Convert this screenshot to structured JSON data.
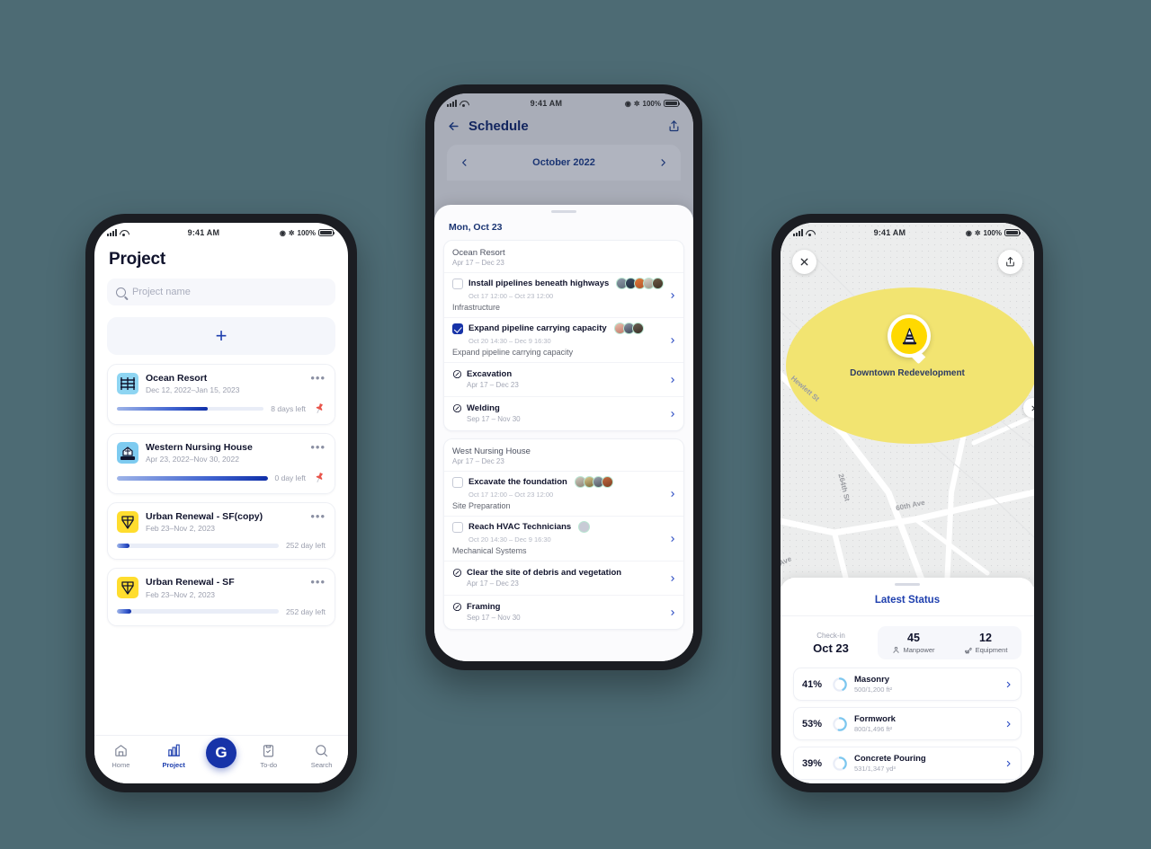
{
  "theme": {
    "background": "#4d6b74",
    "accent": "#1733a8",
    "yellow": "#ffd900",
    "zone": "#f2e471"
  },
  "status_bar": {
    "time": "9:41 AM",
    "battery": "100%"
  },
  "project_screen": {
    "title": "Project",
    "search": {
      "placeholder": "Project name"
    },
    "add_label": "+",
    "projects": [
      {
        "name": "Ocean Resort",
        "dates": "Dec 12, 2022–Jan 15, 2023",
        "progress": 62,
        "days_left": "8 days left",
        "pinned": true,
        "icon": "scaffold-icon",
        "icon_color": "#8ed5f2"
      },
      {
        "name": "Western Nursing House",
        "dates": "Apr 23, 2022–Nov 30, 2022",
        "progress": 100,
        "days_left": "0 day left",
        "pinned": true,
        "icon": "building-icon",
        "icon_color": "#7ecbf0"
      },
      {
        "name": "Urban Renewal - SF(copy)",
        "dates": "Feb 23–Nov 2, 2023",
        "progress": 8,
        "days_left": "252 day left",
        "pinned": false,
        "icon": "gem-icon",
        "icon_color": "#ffdd2e"
      },
      {
        "name": "Urban Renewal - SF",
        "dates": "Feb 23–Nov 2, 2023",
        "progress": 9,
        "days_left": "252 day left",
        "pinned": false,
        "icon": "gem-icon",
        "icon_color": "#ffdd2e"
      }
    ],
    "tabs": [
      {
        "label": "Home",
        "icon": "home-icon",
        "active": false
      },
      {
        "label": "Project",
        "icon": "project-icon",
        "active": true
      },
      {
        "label": "To-do",
        "icon": "todo-icon",
        "active": false
      },
      {
        "label": "Search",
        "icon": "search-icon",
        "active": false
      }
    ],
    "fab_label": "G"
  },
  "schedule_screen": {
    "title": "Schedule",
    "month": "October 2022",
    "day_label": "Mon, Oct 23",
    "groups": [
      {
        "name": "Ocean Resort",
        "dates": "Apr 17 – Dec 23",
        "tasks": [
          {
            "name": "Install pipelines beneath highways",
            "dates": "Oct 17 12:00 – Oct 23 12:00",
            "category": "Infrastructure",
            "checked": false,
            "avatars": 5
          },
          {
            "name": "Expand pipeline carrying capacity",
            "dates": "Oct 20 14:30 – Dec 9 16:30",
            "category": "Expand pipeline carrying capacity",
            "checked": true,
            "avatars": 3
          }
        ],
        "milestones": [
          {
            "name": "Excavation",
            "dates": "Apr 17 – Dec 23"
          },
          {
            "name": "Welding",
            "dates": "Sep 17 – Nov 30"
          }
        ]
      },
      {
        "name": "West Nursing House",
        "dates": "Apr 17 – Dec 23",
        "tasks": [
          {
            "name": "Excavate the foundation",
            "dates": "Oct 17 12:00 – Oct 23 12:00",
            "category": "Site Preparation",
            "checked": false,
            "avatars": 4
          },
          {
            "name": "Reach HVAC Technicians",
            "dates": "Oct 20 14:30 – Dec 9 16:30",
            "category": "Mechanical Systems",
            "checked": false,
            "avatars": 1
          }
        ],
        "milestones": [
          {
            "name": "Clear the site of debris and vegetation",
            "dates": "Apr 17 – Dec 23"
          },
          {
            "name": "Framing",
            "dates": "Sep 17 – Nov 30"
          }
        ]
      }
    ]
  },
  "map_screen": {
    "marker_label": "Downtown Redevelopment",
    "streets": [
      "Hewlett St",
      "264th St",
      "60th Ave",
      "Ave"
    ],
    "sheet_title": "Latest Status",
    "checkin": {
      "label": "Check-in",
      "value": "Oct 23"
    },
    "stats": [
      {
        "value": "45",
        "label": "Manpower",
        "icon": "manpower-icon"
      },
      {
        "value": "12",
        "label": "Equipment",
        "icon": "equipment-icon"
      }
    ],
    "progress_items": [
      {
        "percent": "41%",
        "value": 41,
        "name": "Masonry",
        "sub": "500/1,200 ft²"
      },
      {
        "percent": "53%",
        "value": 53,
        "name": "Formwork",
        "sub": "800/1,496 ft²"
      },
      {
        "percent": "39%",
        "value": 39,
        "name": "Concrete Pouring",
        "sub": "531/1,347 yd³"
      }
    ]
  }
}
